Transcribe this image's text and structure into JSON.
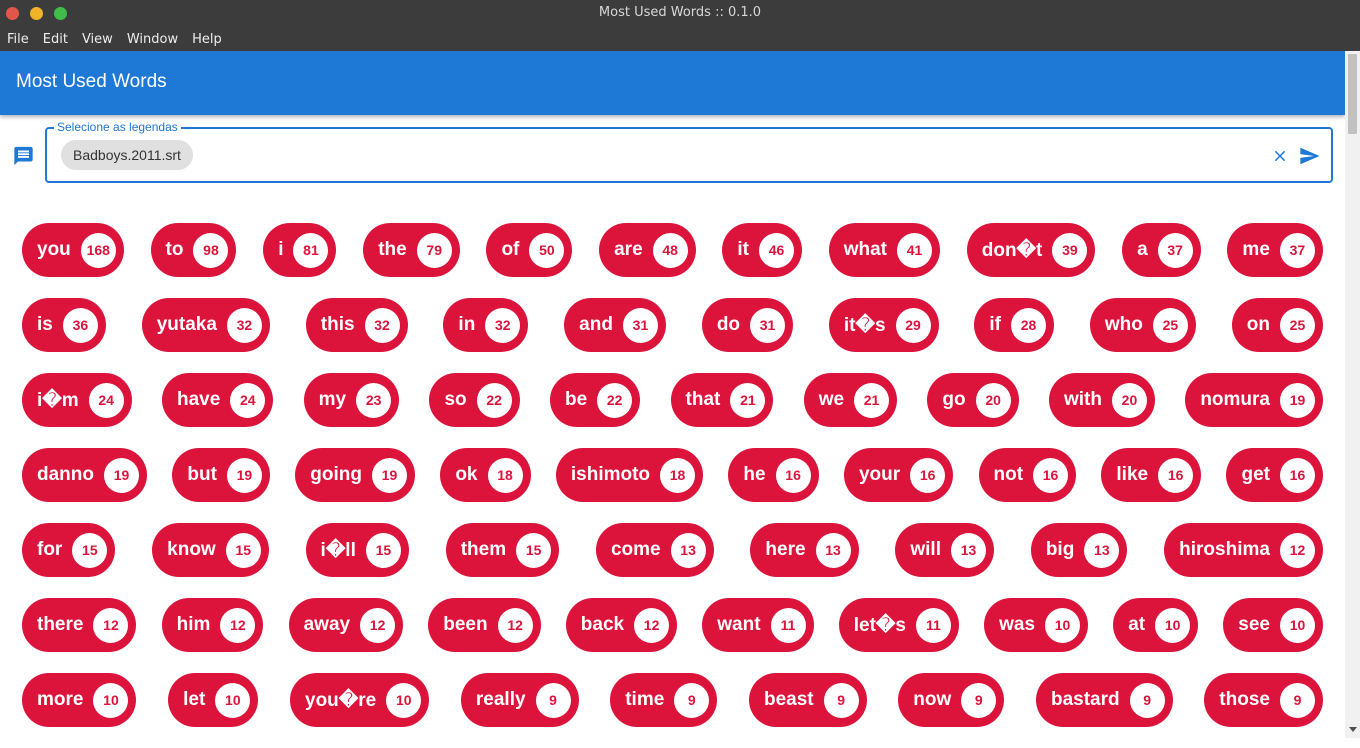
{
  "window": {
    "title": "Most Used Words :: 0.1.0"
  },
  "menu": [
    "File",
    "Edit",
    "View",
    "Window",
    "Help"
  ],
  "appbar": {
    "title": "Most Used Words"
  },
  "selector": {
    "label": "Selecione as legendas",
    "selected_file": "Badboys.2011.srt",
    "subtitle_icon": "subtitles-icon",
    "clear_icon": "close-icon",
    "send_icon": "send-icon"
  },
  "colors": {
    "accent": "#1e78d6",
    "chip": "#dc143c",
    "titlebar": "#3c3c3c"
  },
  "words": [
    [
      {
        "word": "you",
        "count": "168"
      },
      {
        "word": "to",
        "count": "98"
      },
      {
        "word": "i",
        "count": "81"
      },
      {
        "word": "the",
        "count": "79"
      },
      {
        "word": "of",
        "count": "50"
      },
      {
        "word": "are",
        "count": "48"
      },
      {
        "word": "it",
        "count": "46"
      },
      {
        "word": "what",
        "count": "41"
      },
      {
        "word": "don�t",
        "count": "39"
      },
      {
        "word": "a",
        "count": "37"
      },
      {
        "word": "me",
        "count": "37"
      }
    ],
    [
      {
        "word": "is",
        "count": "36"
      },
      {
        "word": "yutaka",
        "count": "32"
      },
      {
        "word": "this",
        "count": "32"
      },
      {
        "word": "in",
        "count": "32"
      },
      {
        "word": "and",
        "count": "31"
      },
      {
        "word": "do",
        "count": "31"
      },
      {
        "word": "it�s",
        "count": "29"
      },
      {
        "word": "if",
        "count": "28"
      },
      {
        "word": "who",
        "count": "25"
      },
      {
        "word": "on",
        "count": "25"
      }
    ],
    [
      {
        "word": "i�m",
        "count": "24"
      },
      {
        "word": "have",
        "count": "24"
      },
      {
        "word": "my",
        "count": "23"
      },
      {
        "word": "so",
        "count": "22"
      },
      {
        "word": "be",
        "count": "22"
      },
      {
        "word": "that",
        "count": "21"
      },
      {
        "word": "we",
        "count": "21"
      },
      {
        "word": "go",
        "count": "20"
      },
      {
        "word": "with",
        "count": "20"
      },
      {
        "word": "nomura",
        "count": "19"
      }
    ],
    [
      {
        "word": "danno",
        "count": "19"
      },
      {
        "word": "but",
        "count": "19"
      },
      {
        "word": "going",
        "count": "19"
      },
      {
        "word": "ok",
        "count": "18"
      },
      {
        "word": "ishimoto",
        "count": "18"
      },
      {
        "word": "he",
        "count": "16"
      },
      {
        "word": "your",
        "count": "16"
      },
      {
        "word": "not",
        "count": "16"
      },
      {
        "word": "like",
        "count": "16"
      },
      {
        "word": "get",
        "count": "16"
      }
    ],
    [
      {
        "word": "for",
        "count": "15"
      },
      {
        "word": "know",
        "count": "15"
      },
      {
        "word": "i�ll",
        "count": "15"
      },
      {
        "word": "them",
        "count": "15"
      },
      {
        "word": "come",
        "count": "13"
      },
      {
        "word": "here",
        "count": "13"
      },
      {
        "word": "will",
        "count": "13"
      },
      {
        "word": "big",
        "count": "13"
      },
      {
        "word": "hiroshima",
        "count": "12"
      }
    ],
    [
      {
        "word": "there",
        "count": "12"
      },
      {
        "word": "him",
        "count": "12"
      },
      {
        "word": "away",
        "count": "12"
      },
      {
        "word": "been",
        "count": "12"
      },
      {
        "word": "back",
        "count": "12"
      },
      {
        "word": "want",
        "count": "11"
      },
      {
        "word": "let�s",
        "count": "11"
      },
      {
        "word": "was",
        "count": "10"
      },
      {
        "word": "at",
        "count": "10"
      },
      {
        "word": "see",
        "count": "10"
      }
    ],
    [
      {
        "word": "more",
        "count": "10"
      },
      {
        "word": "let",
        "count": "10"
      },
      {
        "word": "you�re",
        "count": "10"
      },
      {
        "word": "really",
        "count": "9"
      },
      {
        "word": "time",
        "count": "9"
      },
      {
        "word": "beast",
        "count": "9"
      },
      {
        "word": "now",
        "count": "9"
      },
      {
        "word": "bastard",
        "count": "9"
      },
      {
        "word": "those",
        "count": "9"
      }
    ]
  ]
}
